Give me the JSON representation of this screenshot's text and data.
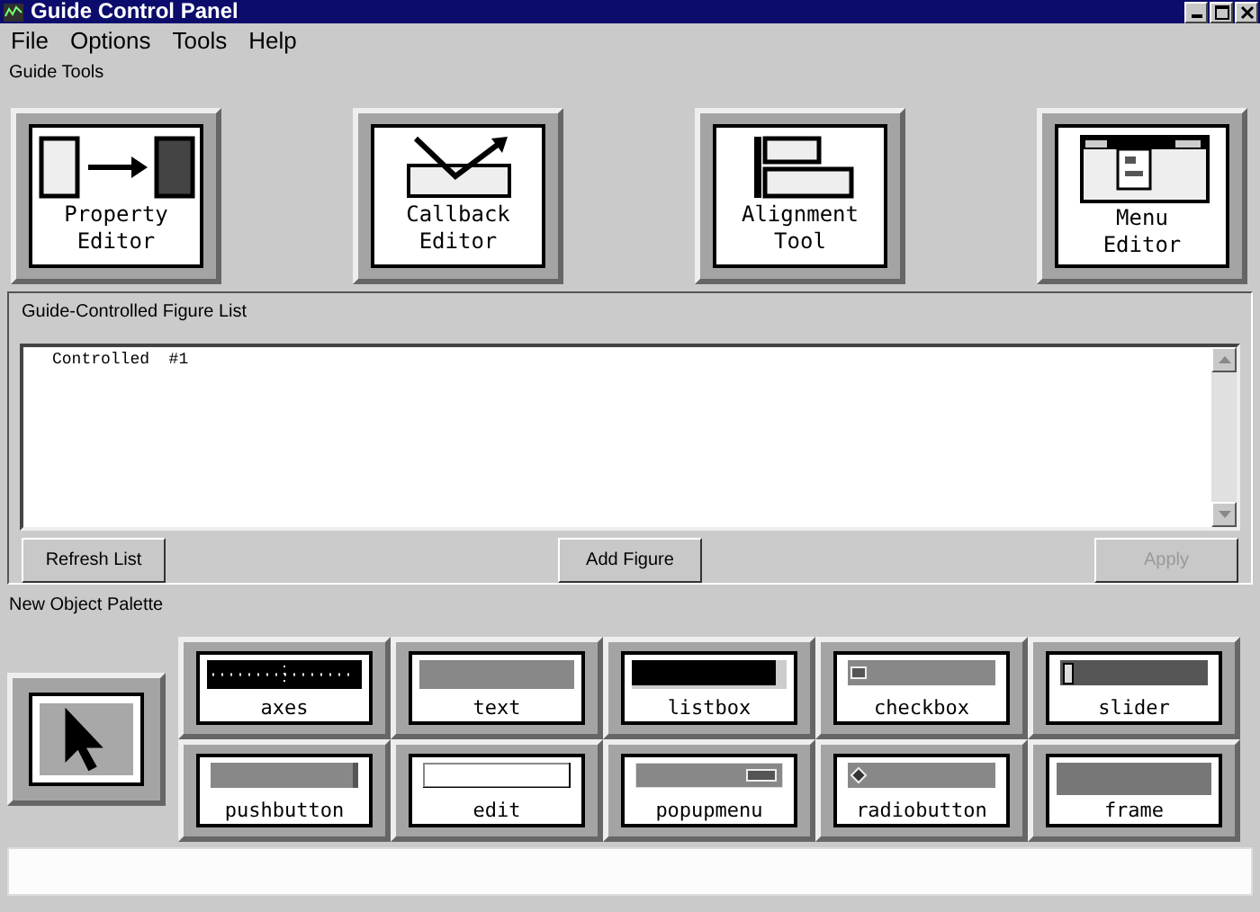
{
  "window": {
    "title": "Guide Control Panel"
  },
  "menu": [
    "File",
    "Options",
    "Tools",
    "Help"
  ],
  "guide_tools": {
    "label": "Guide Tools",
    "tools": [
      {
        "kind": "property",
        "lines": [
          "Property",
          "Editor"
        ]
      },
      {
        "kind": "callback",
        "lines": [
          "Callback",
          "Editor"
        ]
      },
      {
        "kind": "alignment",
        "lines": [
          "Alignment",
          "Tool"
        ]
      },
      {
        "kind": "menu",
        "lines": [
          "Menu",
          "Editor"
        ]
      }
    ]
  },
  "figure_list": {
    "label": "Guide-Controlled Figure List",
    "items": [
      "Controlled  #1"
    ],
    "buttons": [
      {
        "label": "Refresh List",
        "disabled": false
      },
      {
        "label": "Add Figure",
        "disabled": false
      },
      {
        "label": "Apply",
        "disabled": true
      }
    ]
  },
  "palette": {
    "label": "New Object Palette",
    "items": [
      {
        "kind": "axes",
        "label": "axes"
      },
      {
        "kind": "text",
        "label": "text"
      },
      {
        "kind": "listbox",
        "label": "listbox"
      },
      {
        "kind": "checkbox",
        "label": "checkbox"
      },
      {
        "kind": "slider",
        "label": "slider"
      },
      {
        "kind": "pushbutton",
        "label": "pushbutton"
      },
      {
        "kind": "edit",
        "label": "edit"
      },
      {
        "kind": "popupmenu",
        "label": "popupmenu"
      },
      {
        "kind": "radiobutton",
        "label": "radiobutton"
      },
      {
        "kind": "frame",
        "label": "frame"
      }
    ]
  }
}
